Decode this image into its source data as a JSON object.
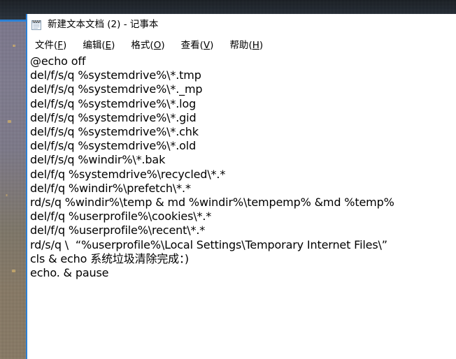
{
  "desktop": {
    "wallpaper_top_color": "#1a222b",
    "wallpaper_accent_color": "#2a7fd4",
    "wallpaper_left_color": "#807a8c"
  },
  "window": {
    "icon": "notepad-icon",
    "title": "新建文本文档 (2) - 记事本",
    "border_color": "#2a7fd4",
    "background": "#ffffff"
  },
  "menubar": {
    "items": [
      {
        "label": "文件",
        "mnemonic": "F"
      },
      {
        "label": "编辑",
        "mnemonic": "E"
      },
      {
        "label": "格式",
        "mnemonic": "O"
      },
      {
        "label": "查看",
        "mnemonic": "V"
      },
      {
        "label": "帮助",
        "mnemonic": "H"
      }
    ]
  },
  "document": {
    "lines": [
      "@echo off",
      "del/f/s/q %systemdrive%\\*.tmp",
      "del/f/s/q %systemdrive%\\*._mp",
      "del/f/s/q %systemdrive%\\*.log",
      "del/f/s/q %systemdrive%\\*.gid",
      "del/f/s/q %systemdrive%\\*.chk",
      "del/f/s/q %systemdrive%\\*.old",
      "del/f/s/q %windir%\\*.bak",
      "del/f/q %systemdrive%\\recycled\\*.*",
      "del/f/q %windir%\\prefetch\\*.*",
      "rd/s/q %windir%\\temp & md %windir%\\tempemp% &md %temp%",
      "del/f/q %userprofile%\\cookies\\*.*",
      "del/f/q %userprofile%\\recent\\*.*",
      "rd/s/q \\  “%userprofile%\\Local Settings\\Temporary Internet Files\\”",
      "cls & echo 系统垃圾清除完成：)",
      "echo. & pause"
    ]
  }
}
